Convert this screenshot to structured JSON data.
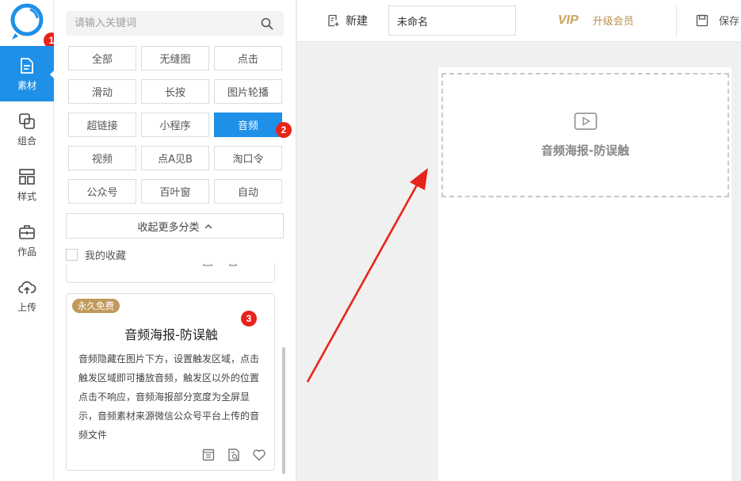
{
  "sidebar": {
    "items": [
      {
        "label": "素材",
        "icon": "file-icon",
        "active": true
      },
      {
        "label": "组合",
        "icon": "combine-icon",
        "active": false
      },
      {
        "label": "样式",
        "icon": "layout-icon",
        "active": false
      },
      {
        "label": "作品",
        "icon": "briefcase-icon",
        "active": false
      },
      {
        "label": "上传",
        "icon": "cloud-upload-icon",
        "active": false
      }
    ]
  },
  "panel": {
    "search_placeholder": "请输入关键词",
    "tags": [
      "全部",
      "无缝图",
      "点击",
      "滑动",
      "长按",
      "图片轮播",
      "超链接",
      "小程序",
      "音频",
      "视频",
      "点A见B",
      "淘口令",
      "公众号",
      "百叶窗",
      "自动"
    ],
    "active_tag": "音频",
    "collapse_label": "收起更多分类",
    "favorites_label": "我的收藏",
    "card": {
      "badge": "永久免费",
      "title": "音频海报-防误触",
      "description": "音频隐藏在图片下方，设置触发区域，点击触发区域即可播放音频，触发区以外的位置点击不响应，音频海报部分宽度为全屏显示，音频素材来源微信公众号平台上传的音频文件"
    }
  },
  "topbar": {
    "new_label": "新建",
    "name_value": "未命名",
    "vip_logo": "VIP",
    "upgrade_label": "升级会员",
    "save_label": "保存"
  },
  "canvas": {
    "placeholder_text": "音频海报-防误触"
  },
  "annotations": {
    "badge1": "1",
    "badge2": "2",
    "badge3": "3"
  },
  "colors": {
    "accent": "#1E90E8",
    "vip": "#c9a25c",
    "badge": "#e8231b",
    "free_label": "#c19a5b"
  }
}
